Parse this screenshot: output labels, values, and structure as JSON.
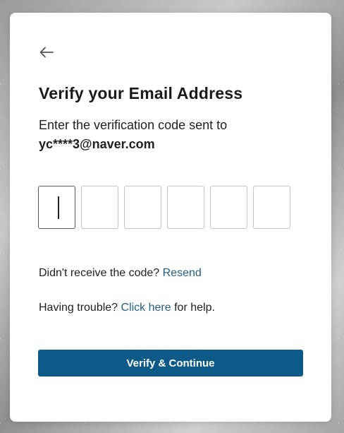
{
  "card": {
    "title": "Verify your Email Address",
    "subtitle_text": "Enter the verification code sent to",
    "email": "yc****3@naver.com"
  },
  "code_inputs": [
    "",
    "",
    "",
    "",
    "",
    ""
  ],
  "resend": {
    "prefix": "Didn't receive the code? ",
    "link": "Resend"
  },
  "help": {
    "prefix": "Having trouble? ",
    "link": "Click here",
    "suffix": " for help."
  },
  "button": {
    "label": "Verify & Continue"
  },
  "colors": {
    "primary": "#0d5a88",
    "link": "#1f5f86"
  },
  "icons": {
    "back": "arrow-left-icon"
  }
}
